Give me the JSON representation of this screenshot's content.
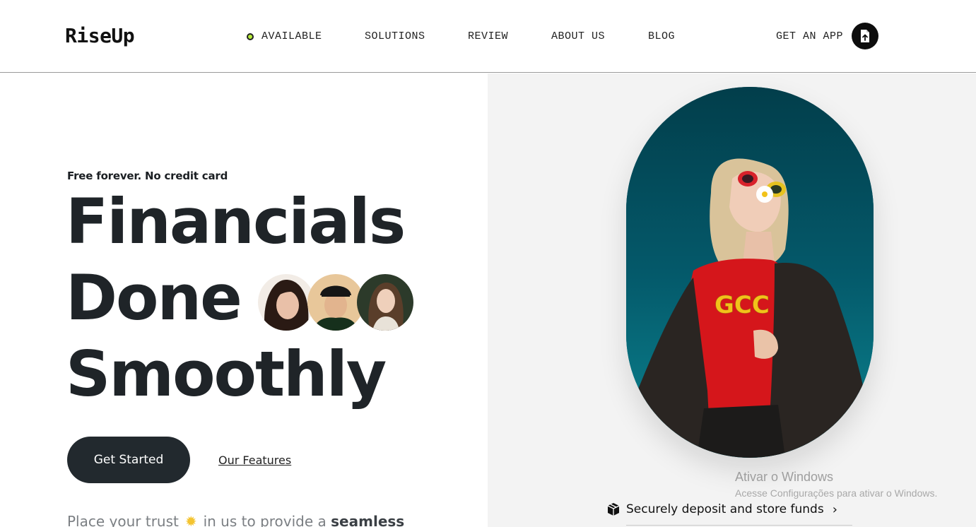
{
  "header": {
    "logo": "RiseUp",
    "nav": [
      {
        "label": "AVAILABLE"
      },
      {
        "label": "SOLUTIONS"
      },
      {
        "label": "REVIEW"
      },
      {
        "label": "ABOUT US"
      },
      {
        "label": "BLOG"
      }
    ],
    "get_app_label": "GET AN APP",
    "get_app_icon": "file-upload-icon",
    "available_dot_color": "#b6ec3a"
  },
  "hero": {
    "tagline": "Free forever. No credit card",
    "headline": [
      "Financials",
      "Done",
      "Smoothly"
    ],
    "cta_label": "Get Started",
    "secondary_link": "Our Features",
    "trust_text_1": "Place your trust",
    "trust_icon": "sun-icon",
    "trust_text_2": "in us to provide a",
    "trust_text_bold": "seamless",
    "avatars": [
      "avatar-woman-curly-hair",
      "avatar-man-cap",
      "avatar-woman-long-hair"
    ]
  },
  "right_panel": {
    "photo": "woman-sunglasses-flower-photo",
    "deposit_label": "Securely deposit and store funds",
    "deposit_icon": "box-icon",
    "deposit_chevron": "›"
  },
  "os_watermark": {
    "title": "Ativar o Windows",
    "subtitle": "Acesse Configurações para ativar o Windows."
  },
  "colors": {
    "dark": "#22292e",
    "accent_green": "#b6ec3a",
    "panel_bg": "#f3f3f3"
  }
}
